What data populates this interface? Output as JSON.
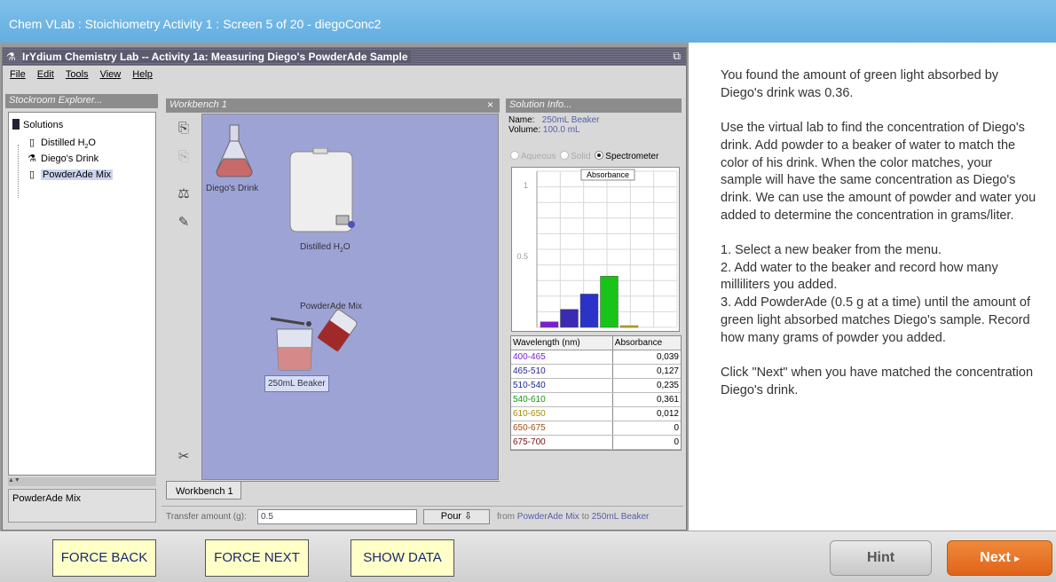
{
  "topbar": {
    "title": "Chem VLab : Stoichiometry Activity 1 : Screen 5 of 20 - diegoConc2"
  },
  "applet": {
    "window_title": "IrYdium Chemistry Lab -- Activity 1a: Measuring Diego's PowderAde Sample",
    "menu": [
      "File",
      "Edit",
      "Tools",
      "View",
      "Help"
    ],
    "stockroom": {
      "header": "Stockroom Explorer...",
      "root": "Solutions",
      "items": [
        "Distilled H2O",
        "Diego's Drink",
        "PowderAde Mix"
      ],
      "selected_label": "PowderAde Mix"
    },
    "workbench": {
      "header": "Workbench 1",
      "close": "×",
      "tab": "Workbench 1",
      "labels": {
        "diegos_drink": "Diego's Drink",
        "distilled": "Distilled H",
        "distilled_sub": "2",
        "distilled_end": "O",
        "powderade": "PowderAde Mix",
        "beaker": "250mL Beaker"
      }
    },
    "solution_info": {
      "header": "Solution Info...",
      "name_label": "Name:",
      "name_value": "250mL Beaker",
      "volume_label": "Volume:",
      "volume_value": "100.0 mL",
      "radios": [
        {
          "label": "Aqueous",
          "enabled": false,
          "checked": false
        },
        {
          "label": "Solid",
          "enabled": false,
          "checked": false
        },
        {
          "label": "Spectrometer",
          "enabled": true,
          "checked": true
        }
      ]
    },
    "transfer": {
      "label": "Transfer amount (g):",
      "value": "0.5",
      "pour": "Pour",
      "from_label": "from",
      "from_value": "PowderAde Mix",
      "to_label": "to",
      "to_value": "250mL Beaker"
    }
  },
  "chart_data": {
    "type": "bar",
    "title": "Absorbance",
    "ylim": [
      0,
      1.1
    ],
    "yticks": [
      "1",
      "0.5"
    ],
    "categories": [
      "400-465",
      "465-510",
      "510-540",
      "540-610",
      "610-650",
      "650-675",
      "675-700"
    ],
    "values": [
      0.039,
      0.127,
      0.235,
      0.361,
      0.012,
      0,
      0
    ],
    "colors": [
      "#7a1fd6",
      "#3a2bb0",
      "#2a32c8",
      "#19c419",
      "#c8b800",
      "#b06010",
      "#8a1010"
    ],
    "grid": true
  },
  "table": {
    "headers": [
      "Wavelength (nm)",
      "Absorbance"
    ],
    "rows": [
      {
        "range": "400-465",
        "value": "0,039",
        "color": "#7a1fd6"
      },
      {
        "range": "465-510",
        "value": "0,127",
        "color": "#2a2a90"
      },
      {
        "range": "510-540",
        "value": "0,235",
        "color": "#1a2a8a"
      },
      {
        "range": "540-610",
        "value": "0,361",
        "color": "#119911"
      },
      {
        "range": "610-650",
        "value": "0,012",
        "color": "#a09000"
      },
      {
        "range": "650-675",
        "value": "0",
        "color": "#a05010"
      },
      {
        "range": "675-700",
        "value": "0",
        "color": "#7a1010"
      }
    ]
  },
  "instructions": {
    "p1": "You found the amount of green light absorbed by Diego's drink was 0.36.",
    "p2": "Use the virtual lab to find the concentration of Diego's drink. Add powder to a beaker of water to match the color of his drink. When the color matches, your sample will have the same concentration as Diego's drink. We can use the amount of powder and water you added to determine the concentration in grams/liter.",
    "step1": "1. Select a new beaker from the menu.",
    "step2": "2. Add water to the beaker and record how many milliliters you added.",
    "step3": "3. Add PowderAde (0.5 g at a time) until the amount of green light absorbed matches Diego's sample. Record how many grams of powder you added.",
    "p4": "Click \"Next\" when you have matched the concentration Diego's drink."
  },
  "footer": {
    "force_back": "FORCE BACK",
    "force_next": "FORCE NEXT",
    "show_data": "SHOW DATA",
    "hint": "Hint",
    "next": "Next"
  }
}
